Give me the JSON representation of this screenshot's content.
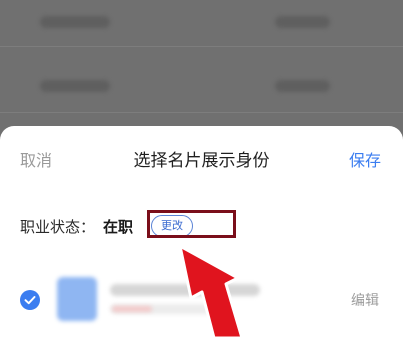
{
  "sheet": {
    "cancel_label": "取消",
    "title": "选择名片展示身份",
    "save_label": "保存"
  },
  "employment": {
    "label": "职业状态：",
    "value": "在职",
    "change_label": "更改"
  },
  "card": {
    "edit_label": "编辑"
  },
  "colors": {
    "accent": "#3b7df0",
    "highlight_border": "#7a0e1a",
    "arrow": "#e0141e"
  },
  "icons": {
    "selected": "check-circle-icon",
    "pointer": "red-arrow-icon"
  }
}
